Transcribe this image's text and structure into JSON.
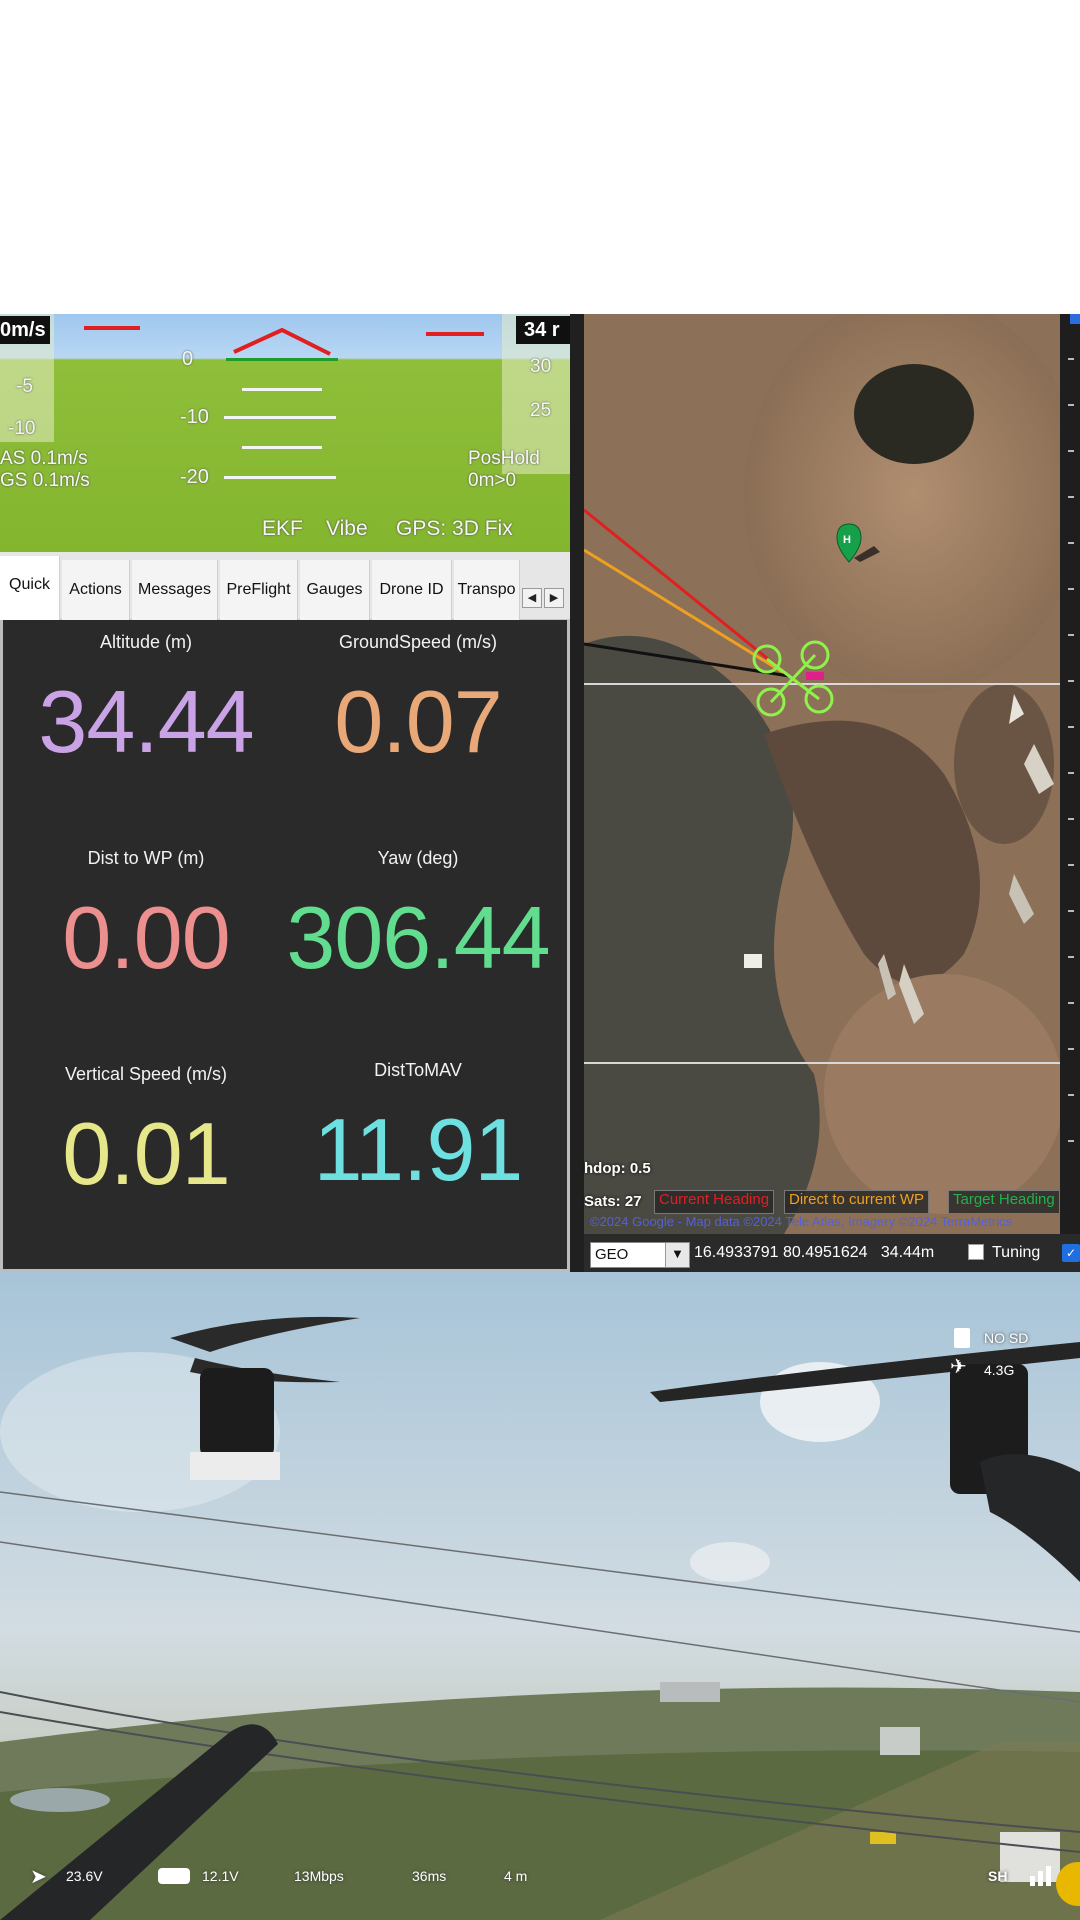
{
  "hud": {
    "airspeed_box": "0m/s",
    "altitude_box": "34 r",
    "left_tape": [
      "-5",
      "-10"
    ],
    "right_tape": [
      "30",
      "25"
    ],
    "pitch": [
      "0",
      "-10",
      "-20"
    ],
    "as_text": "AS 0.1m/s",
    "gs_text": "GS 0.1m/s",
    "mode": "PosHold",
    "wp_text": "0m>0",
    "ekf": "EKF",
    "vibe": "Vibe",
    "gps": "GPS: 3D Fix"
  },
  "tabs": {
    "items": [
      "Quick",
      "Actions",
      "Messages",
      "PreFlight",
      "Gauges",
      "Drone ID",
      "Transpo"
    ],
    "active": "Quick"
  },
  "quick": {
    "altitude": {
      "label": "Altitude (m)",
      "value": "34.44",
      "color": "#c9a3e6"
    },
    "groundspeed": {
      "label": "GroundSpeed (m/s)",
      "value": "0.07",
      "color": "#e8a878"
    },
    "dist_to_wp": {
      "label": "Dist to WP (m)",
      "value": "0.00",
      "color": "#ec8f8f"
    },
    "yaw": {
      "label": "Yaw (deg)",
      "value": "306.44",
      "color": "#62dc8e"
    },
    "vertical_speed": {
      "label": "Vertical Speed (m/s)",
      "value": "0.01",
      "color": "#e6e68a"
    },
    "dist_to_mav": {
      "label": "DistToMAV",
      "value": "11.91",
      "color": "#6ee0e0"
    }
  },
  "map": {
    "hdop": "hdop: 0.5",
    "sats": "Sats: 27",
    "legend": [
      {
        "label": "Current Heading",
        "color": "#e02020"
      },
      {
        "label": "Direct to current WP",
        "color": "#f0a020"
      },
      {
        "label": "Target Heading",
        "color": "#22b14c"
      }
    ],
    "copyright": "©2024 Google - Map data ©2024 Tele Atlas, Imagery ©2024 TerraMetrics",
    "coord_system": "GEO",
    "coords": "16.4933791 80.4951624",
    "alt": "34.44m",
    "tuning": "Tuning"
  },
  "fpv": {
    "sd_status": "NO SD",
    "link_status": "4.3G",
    "battery_voltage": "23.6V",
    "goggle_voltage": "12.1V",
    "bitrate": "13Mbps",
    "latency": "36ms",
    "distance": "4 m",
    "mode": "SH"
  }
}
